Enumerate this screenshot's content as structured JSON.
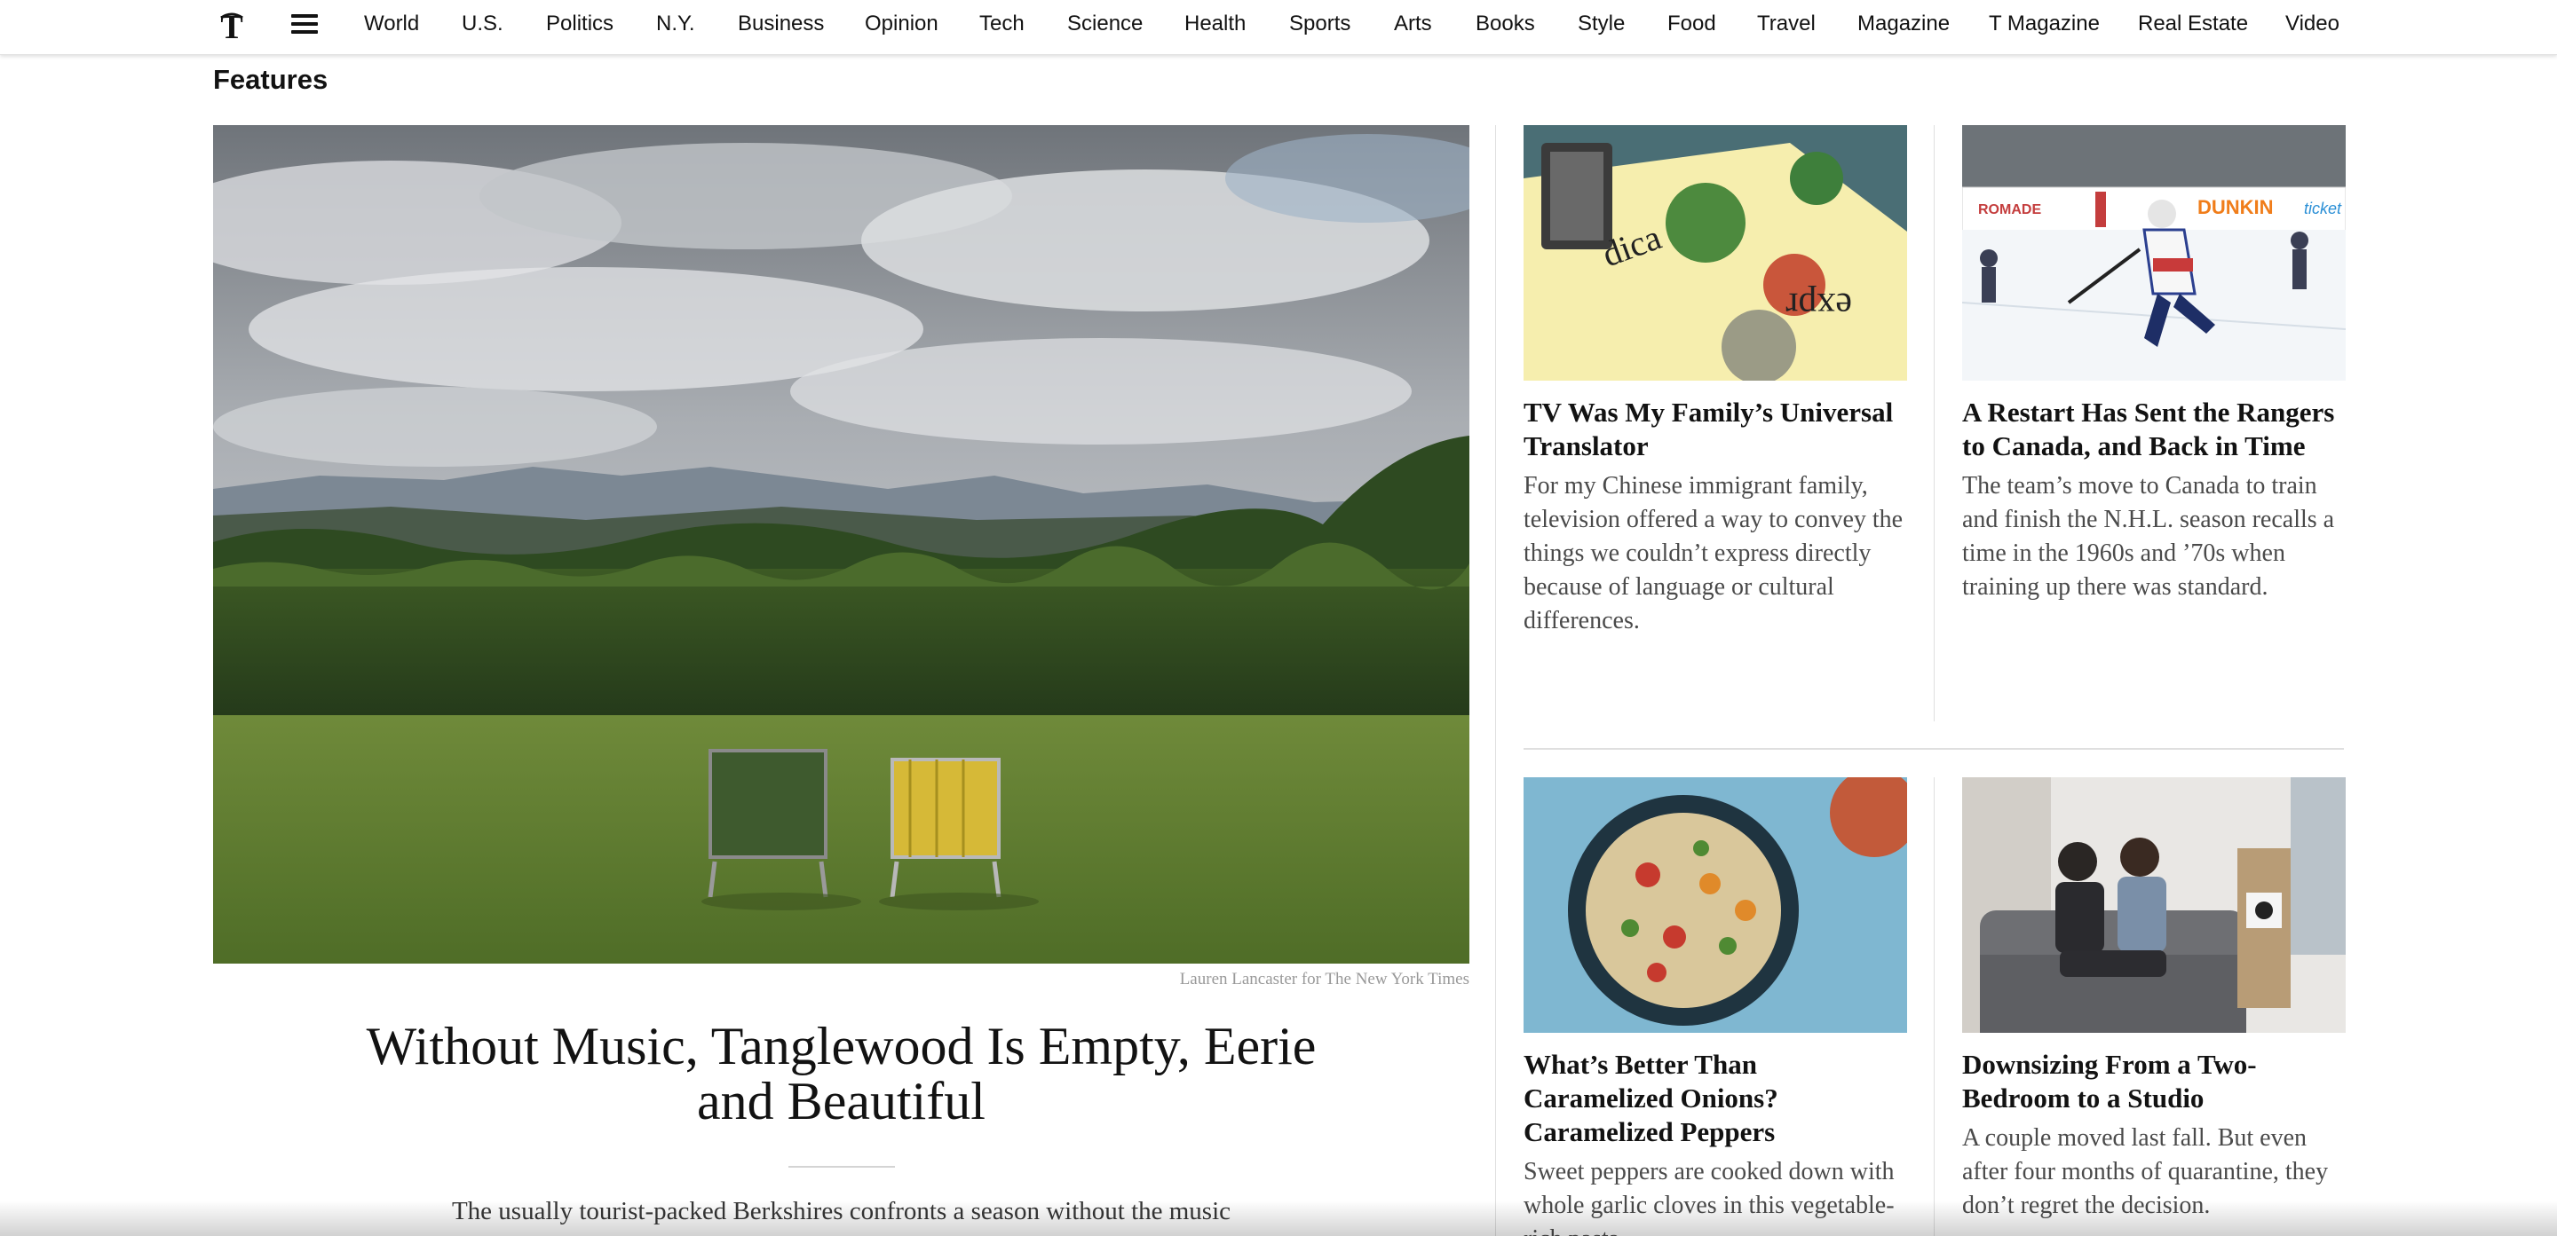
{
  "nav": {
    "logo": "nyt-logo",
    "menu_icon": "hamburger-icon",
    "items": [
      "World",
      "U.S.",
      "Politics",
      "N.Y.",
      "Business",
      "Opinion",
      "Tech",
      "Science",
      "Health",
      "Sports",
      "Arts",
      "Books",
      "Style",
      "Food",
      "Travel",
      "Magazine",
      "T Magazine",
      "Real Estate",
      "Video"
    ]
  },
  "section": {
    "title": "Features"
  },
  "lead": {
    "credit": "Lauren Lancaster for The New York Times",
    "headline": "Without Music, Tanglewood Is Empty, Eerie and Beautiful",
    "summary": "The usually tourist-packed Berkshires confronts a season without the music"
  },
  "cards": [
    {
      "headline": "TV Was My Family’s Universal Translator",
      "summary": "For my Chinese immigrant family, television offered a way to convey the things we couldn’t express directly because of language or cultural differences."
    },
    {
      "headline": "A Restart Has Sent the Rangers to Canada, and Back in Time",
      "summary": "The team’s move to Canada to train and finish the N.H.L. season recalls a time in the 1960s and ’70s when training up there was standard."
    },
    {
      "headline": "What’s Better Than Caramelized Onions? Caramelized Peppers",
      "summary": "Sweet peppers are cooked down with whole garlic cloves in this vegetable-rich pasta."
    },
    {
      "headline": "Downsizing From a Two-Bedroom to a Studio",
      "summary": "A couple moved last fall. But even after four months of quarantine, they don’t regret the decision."
    }
  ],
  "hockey_board_text": {
    "brand": "DUNKIN",
    "ticket": "ticket",
    "made": "ROMADE"
  },
  "colors": {
    "text": "#121212",
    "summary": "#4a4a4a",
    "credit": "#999999",
    "divider": "#dfdfdf"
  }
}
